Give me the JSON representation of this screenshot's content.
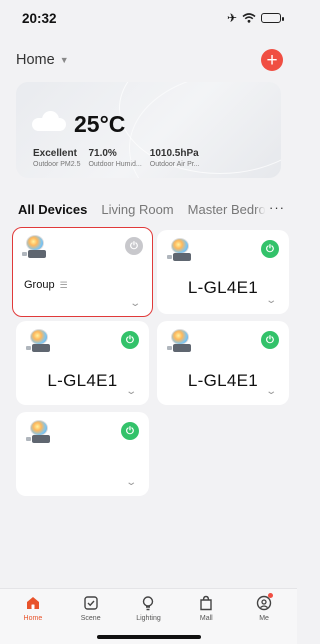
{
  "status_bar": {
    "time": "20:32"
  },
  "header": {
    "home_label": "Home",
    "add_symbol": "+"
  },
  "weather": {
    "temperature": "25°C",
    "metrics": [
      {
        "value": "Excellent",
        "label": "Outdoor PM2.5"
      },
      {
        "value": "71.0%",
        "label": "Outdoor Humid..."
      },
      {
        "value": "1010.5hPa",
        "label": "Outdoor Air Pr..."
      }
    ]
  },
  "tabs": {
    "items": [
      "All Devices",
      "Living Room",
      "Master Bedro"
    ],
    "more": "···"
  },
  "devices": [
    {
      "name": "Group",
      "power": "off",
      "selected": true
    },
    {
      "name": "L-GL4E1",
      "power": "on"
    },
    {
      "name": "L-GL4E1",
      "power": "on"
    },
    {
      "name": "L-GL4E1",
      "power": "on"
    },
    {
      "name": "",
      "power": "on"
    }
  ],
  "nav": {
    "items": [
      {
        "label": "Home",
        "icon": "home-icon",
        "active": true
      },
      {
        "label": "Scene",
        "icon": "scene-checkbox-icon"
      },
      {
        "label": "Lighting",
        "icon": "bulb-icon"
      },
      {
        "label": "Mall",
        "icon": "bag-icon"
      },
      {
        "label": "Me",
        "icon": "profile-icon"
      }
    ]
  },
  "colors": {
    "accent": "#e8532b",
    "power_on": "#33c26a",
    "add_button": "#f04e42"
  }
}
